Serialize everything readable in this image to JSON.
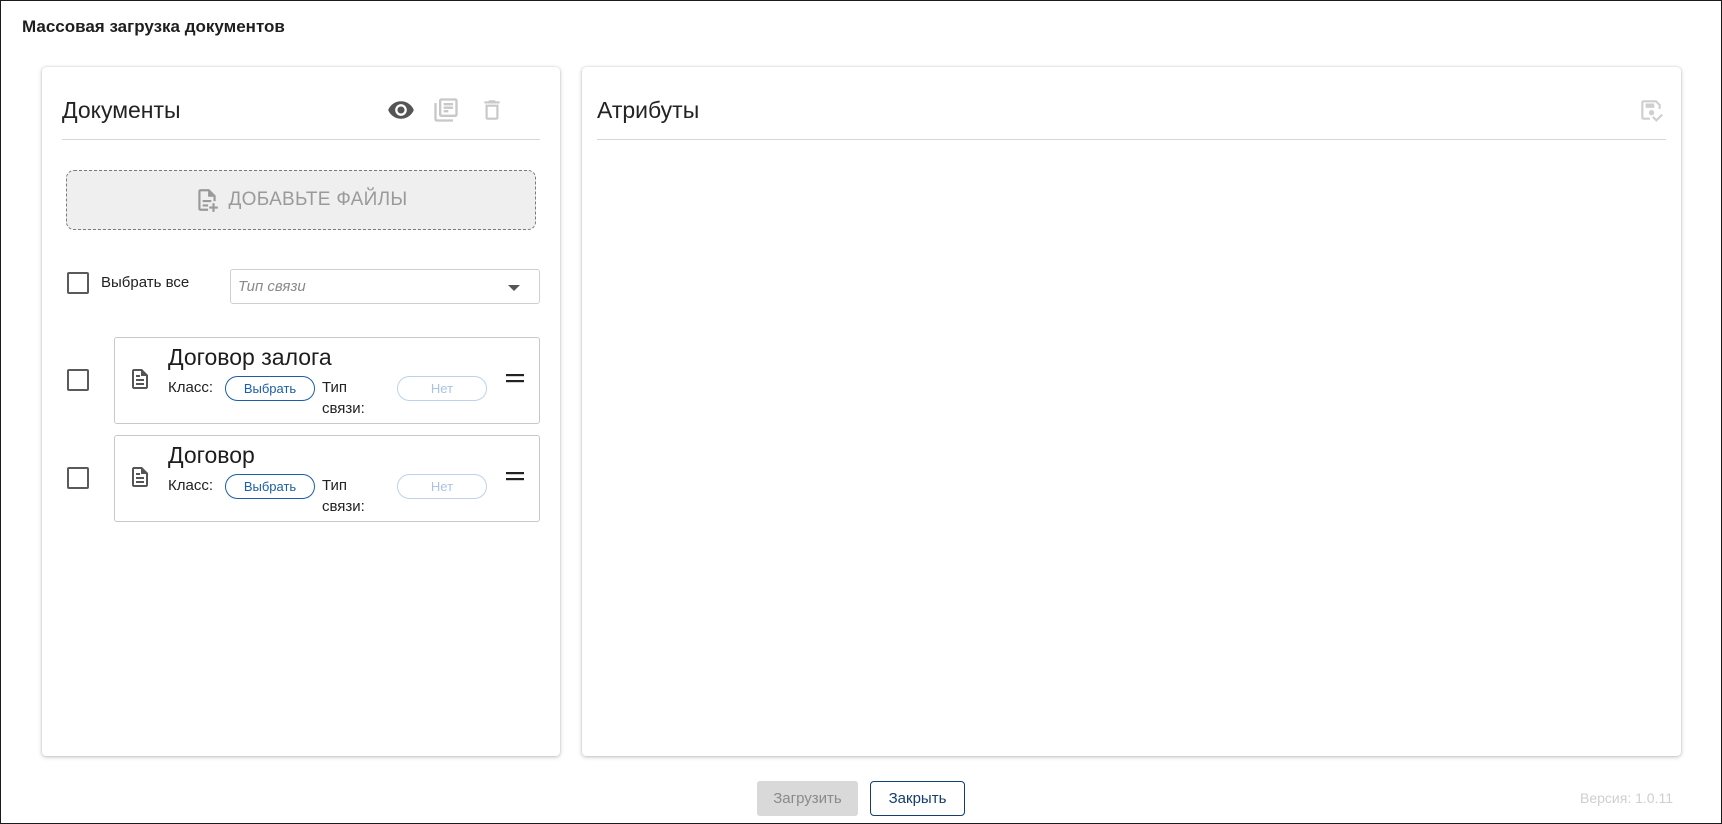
{
  "window": {
    "title": "Массовая загрузка документов"
  },
  "documents_panel": {
    "title": "Документы",
    "add_files_label": "ДОБАВЬТЕ ФАЙЛЫ",
    "select_all_label": "Выбрать все",
    "link_type_placeholder": "Тип связи",
    "items": [
      {
        "name": "Договор залога",
        "class_label": "Класс:",
        "choose_label": "Выбрать",
        "link_type_label": "Тип связи:",
        "link_value": "Нет"
      },
      {
        "name": "Договор",
        "class_label": "Класс:",
        "choose_label": "Выбрать",
        "link_type_label": "Тип связи:",
        "link_value": "Нет"
      }
    ],
    "icons": [
      "eye-icon",
      "copy-list-icon",
      "delete-icon"
    ]
  },
  "attributes_panel": {
    "title": "Атрибуты",
    "icons": [
      "save-icon"
    ]
  },
  "footer": {
    "upload_label": "Загрузить",
    "close_label": "Закрыть",
    "version": "Версия: 1.0.11"
  },
  "colors": {
    "accent": "#1a5fa8",
    "close_button": "#123e70",
    "disabled": "#d9d9d9"
  }
}
